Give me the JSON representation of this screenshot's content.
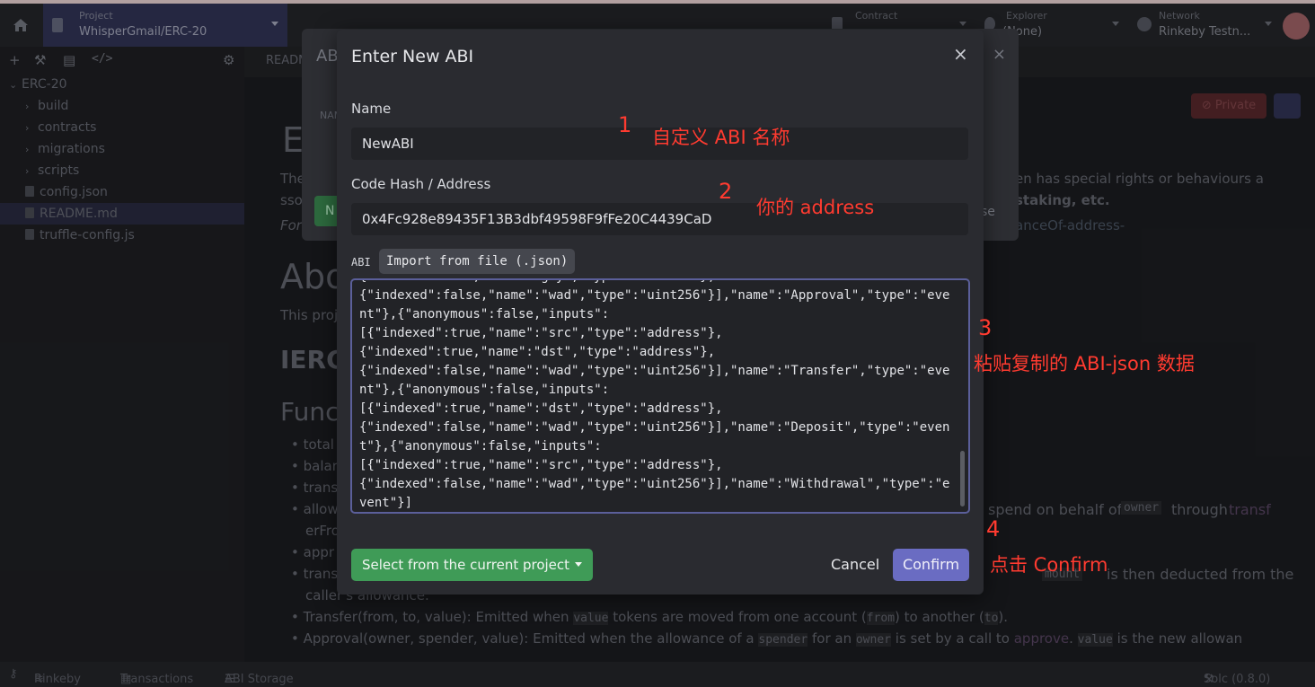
{
  "topbar": {
    "project_label": "Project",
    "project_value": "WhisperGmail/ERC-20",
    "contract_label": "Contract",
    "explorer_label": "Explorer",
    "explorer_value": "(None)",
    "network_label": "Network",
    "network_value": "Rinkeby Testn..."
  },
  "sidebar": {
    "items": [
      {
        "label": "ERC-20"
      },
      {
        "label": "build"
      },
      {
        "label": "contracts"
      },
      {
        "label": "migrations"
      },
      {
        "label": "scripts"
      },
      {
        "label": "config.json"
      },
      {
        "label": "README.md"
      },
      {
        "label": "truffle-config.js"
      }
    ]
  },
  "background": {
    "tab_label": "README",
    "private_label": "Private",
    "heading_e": "E",
    "text_line1": "The",
    "text_line1_right": "en has special rights or behaviours a",
    "text_line2": "sso",
    "text_line2_right": "staking, etc.",
    "text_line3": "For",
    "text_line3_right": "anceOf-address-",
    "about": "Abo",
    "this_proj": "This proj",
    "ierc": "IERC",
    "func": "Func",
    "bullets": [
      "total",
      "balar",
      "trans",
      "allow",
      "erFro",
      "appr",
      "trans"
    ],
    "spend_text": "spend on behalf of",
    "owner_code": "owner",
    "through_text": "through",
    "transf_text": "transf",
    "amount_text": "mount",
    "deducted_text": "is then deducted from the",
    "callers_text": "caller's allowance.",
    "transfer_event": "Transfer(from, to, value): Emitted when",
    "value_code": "value",
    "tokens_moved": "tokens are moved from one account (",
    "from_code": "from",
    "to_another": ") to another (",
    "to_code": "to",
    "close_paren": ").",
    "approval_event": "Approval(owner, spender, value): Emitted when the allowance of a",
    "spender_code": "spender",
    "for_an": "for an",
    "owner_code2": "owner",
    "is_set": "is set by a call to",
    "approve_text": "approve",
    "value_code2": "value",
    "new_allowance": "is the new allowan",
    "bg_modal_title": "AB",
    "bg_modal_name": "NAM",
    "bg_modal_btn": "N",
    "bg_modal_se": "se"
  },
  "footer": {
    "network": "Rinkeby",
    "transactions": "Transactions",
    "abi_storage": "ABI Storage",
    "solc": "Solc (0.8.0)"
  },
  "modal": {
    "title": "Enter New ABI",
    "close": "×",
    "name_label": "Name",
    "name_value": "NewABI",
    "address_label": "Code Hash / Address",
    "address_value": "0x4Fc928e89435F13B3dbf49598F9fFe20C4439CaD",
    "abi_label": "ABI",
    "import_label": "Import from file (.json)",
    "abi_text": "{\"indexed\":true,\"name\":\"guy\",\"type\":\"address\"},\n{\"indexed\":false,\"name\":\"wad\",\"type\":\"uint256\"}],\"name\":\"Approval\",\"type\":\"event\"},{\"anonymous\":false,\"inputs\":\n[{\"indexed\":true,\"name\":\"src\",\"type\":\"address\"},\n{\"indexed\":true,\"name\":\"dst\",\"type\":\"address\"},\n{\"indexed\":false,\"name\":\"wad\",\"type\":\"uint256\"}],\"name\":\"Transfer\",\"type\":\"event\"},{\"anonymous\":false,\"inputs\":\n[{\"indexed\":true,\"name\":\"dst\",\"type\":\"address\"},\n{\"indexed\":false,\"name\":\"wad\",\"type\":\"uint256\"}],\"name\":\"Deposit\",\"type\":\"event\"},{\"anonymous\":false,\"inputs\":\n[{\"indexed\":true,\"name\":\"src\",\"type\":\"address\"},\n{\"indexed\":false,\"name\":\"wad\",\"type\":\"uint256\"}],\"name\":\"Withdrawal\",\"type\":\"event\"}]",
    "select_label": "Select from the current project",
    "cancel_label": "Cancel",
    "confirm_label": "Confirm"
  },
  "annotations": {
    "n1": "1",
    "t1": "自定义 ABI 名称",
    "n2": "2",
    "t2": "你的 address",
    "n3": "3",
    "t3": "粘贴复制的 ABI-json 数据",
    "n4": "4",
    "t4": "点击 Confirm"
  },
  "colors": {
    "accent": "#6a6cc2",
    "success": "#3f9b57",
    "annotation": "#ff3b30"
  }
}
